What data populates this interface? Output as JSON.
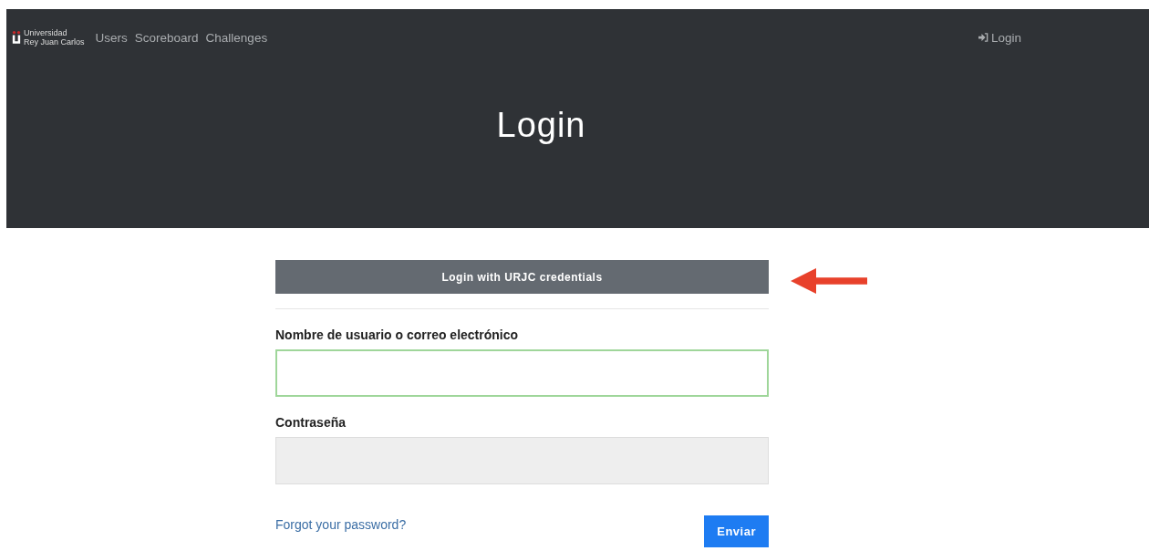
{
  "navbar": {
    "logo_lines": [
      "Universidad",
      "Rey Juan Carlos"
    ],
    "links": [
      {
        "label": "Users"
      },
      {
        "label": "Scoreboard"
      },
      {
        "label": "Challenges"
      }
    ],
    "login_link": {
      "label": "Login"
    }
  },
  "header": {
    "title": "Login"
  },
  "form": {
    "sso_button": "Login with URJC credentials",
    "fields": [
      {
        "label": "Nombre de usuario o correo electrónico",
        "focused": true
      },
      {
        "label": "Contraseña",
        "focused": false
      }
    ],
    "forgot_link": "Forgot your password?",
    "submit_button": "Enviar"
  }
}
